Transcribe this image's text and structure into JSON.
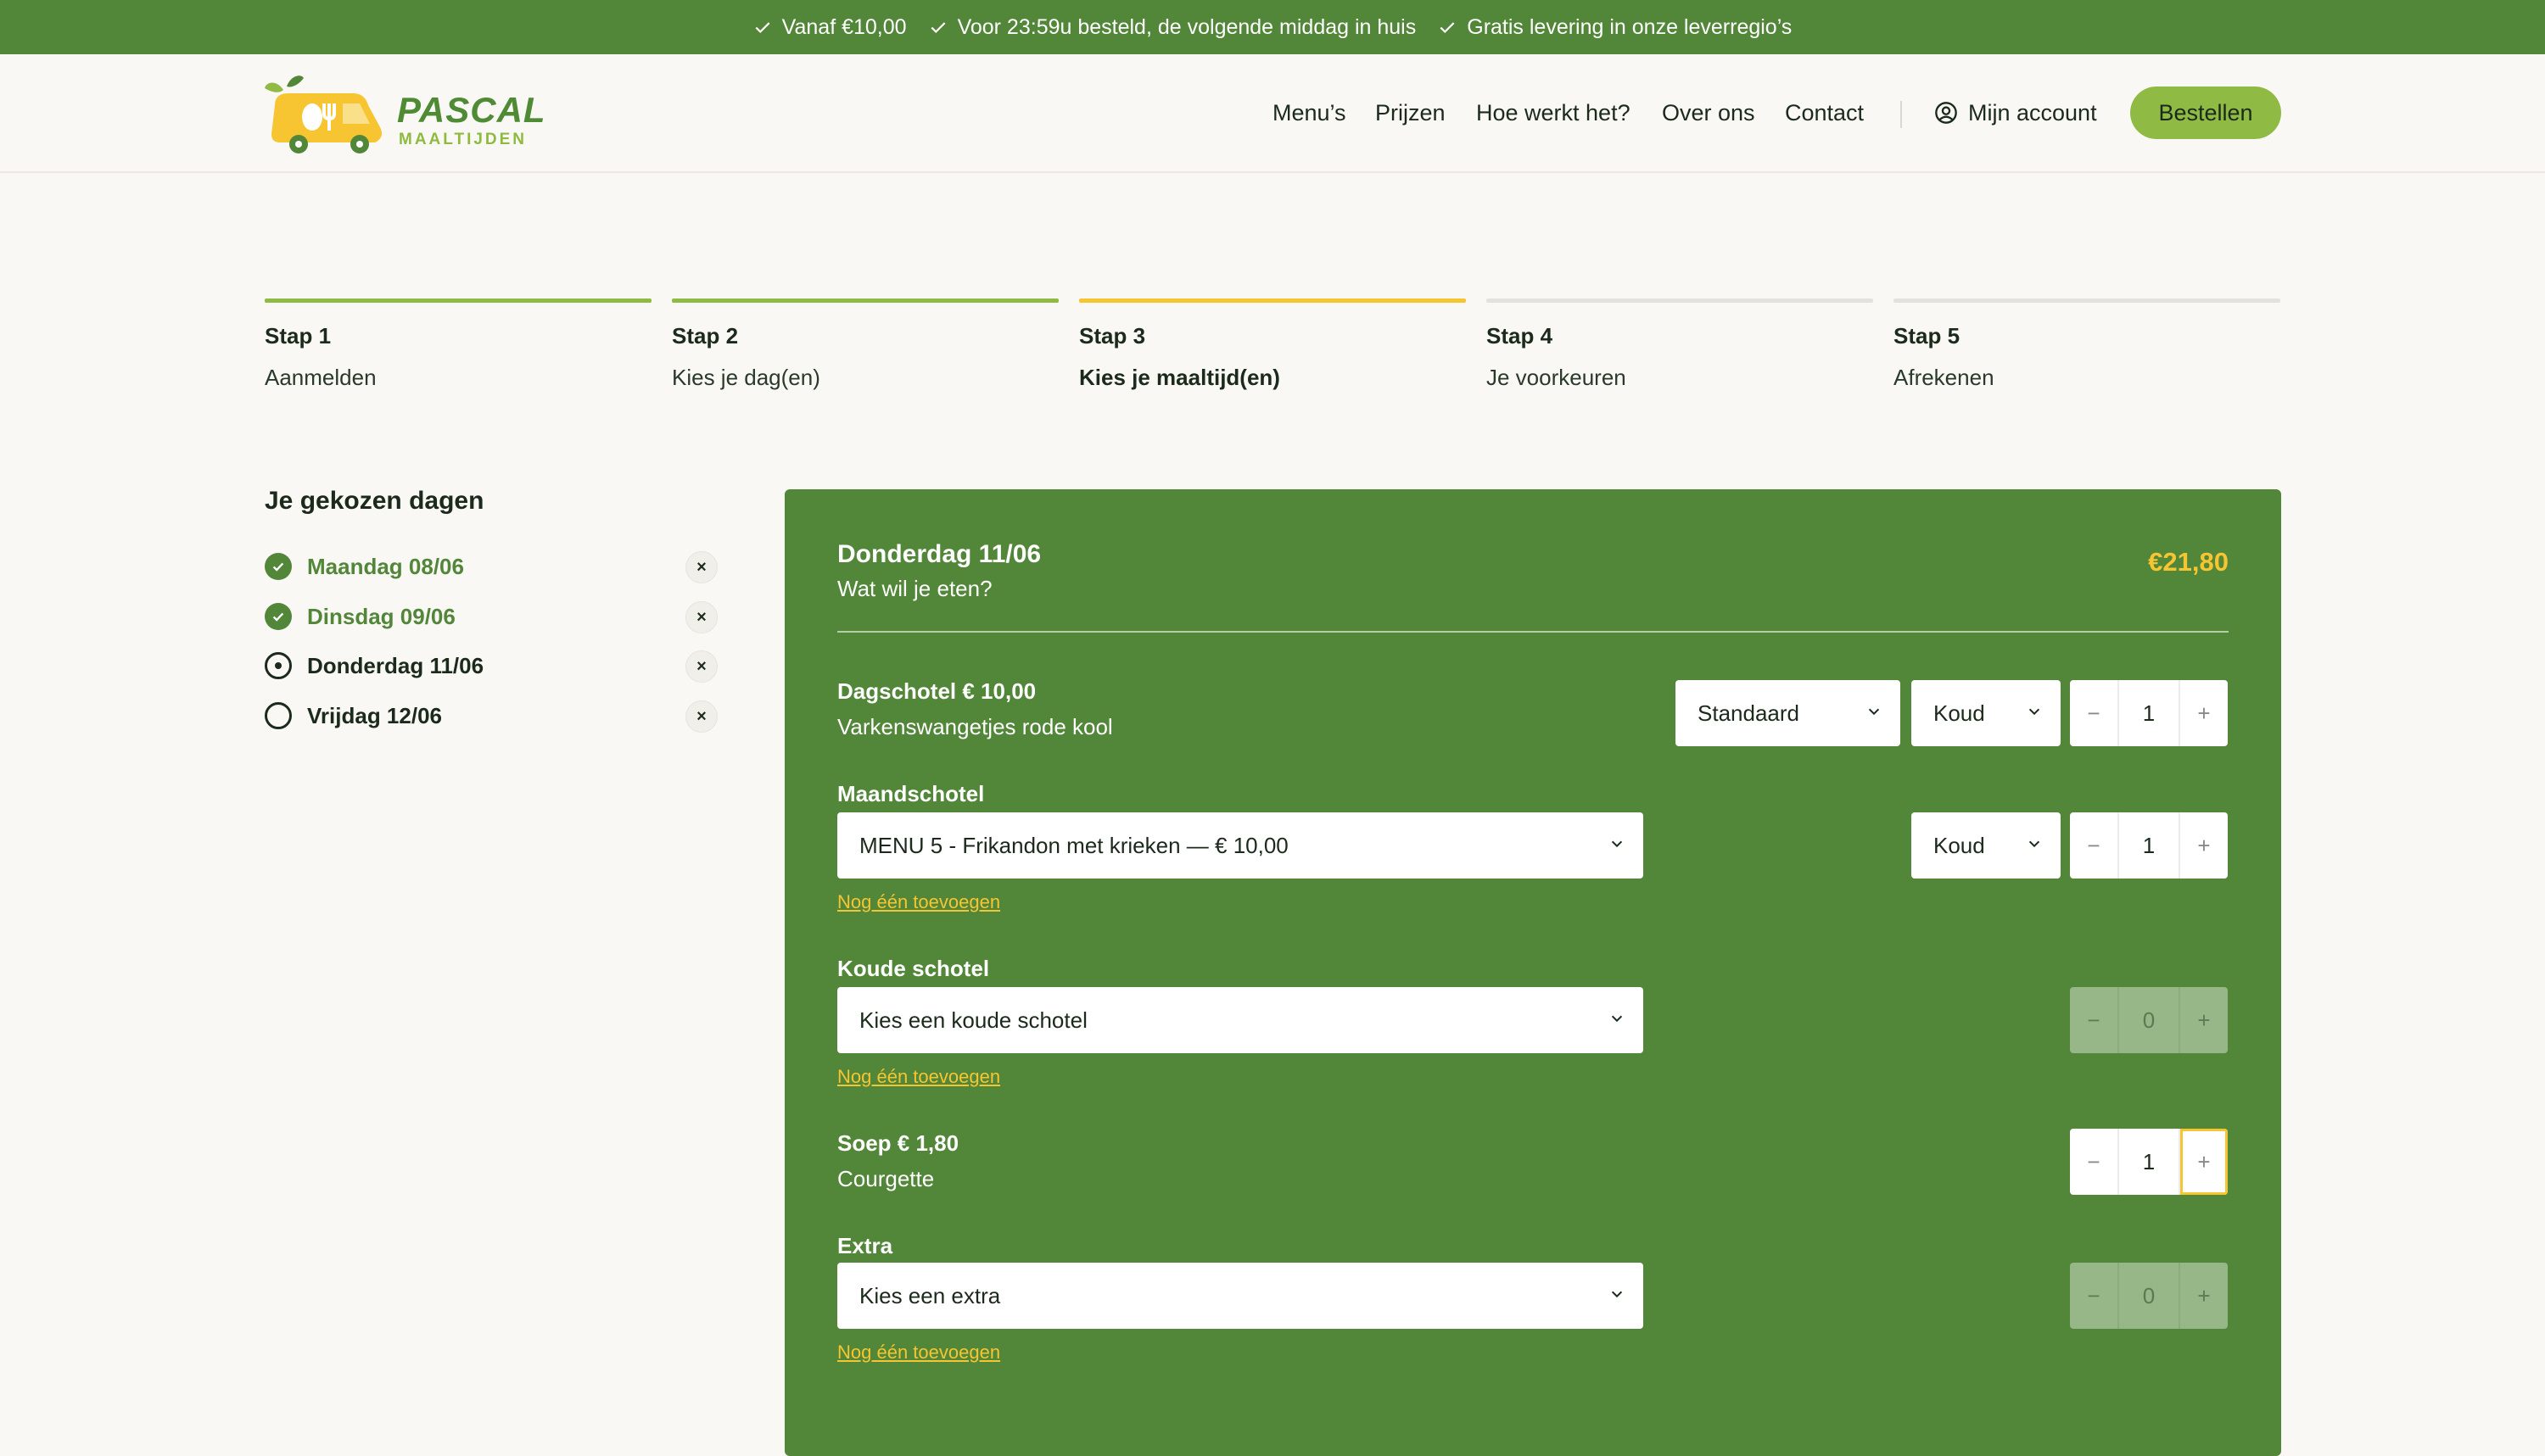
{
  "topbar": {
    "usps": [
      "Vanaf €10,00",
      "Voor 23:59u besteld, de volgende middag in huis",
      "Gratis levering in onze leverregio’s"
    ]
  },
  "header": {
    "logo_main": "PASCAL",
    "logo_sub": "MAALTIJDEN",
    "nav": [
      "Menu’s",
      "Prijzen",
      "Hoe werkt het?",
      "Over ons",
      "Contact"
    ],
    "account": "Mijn account",
    "order_button": "Bestellen"
  },
  "steps": [
    {
      "num": "Stap 1",
      "label": "Aanmelden",
      "state": "done",
      "color": "#8fbb44"
    },
    {
      "num": "Stap 2",
      "label": "Kies je dag(en)",
      "state": "done",
      "color": "#8fbb44"
    },
    {
      "num": "Stap 3",
      "label": "Kies je maaltijd(en)",
      "state": "active",
      "color": "#f7c531"
    },
    {
      "num": "Stap 4",
      "label": "Je voorkeuren",
      "state": "todo",
      "color": "#e4e2dc"
    },
    {
      "num": "Stap 5",
      "label": "Afrekenen",
      "state": "todo",
      "color": "#e4e2dc"
    }
  ],
  "sidebar": {
    "title": "Je gekozen dagen",
    "days": [
      {
        "label": "Maandag 08/06",
        "status": "done"
      },
      {
        "label": "Dinsdag 09/06",
        "status": "done"
      },
      {
        "label": "Donderdag 11/06",
        "status": "current"
      },
      {
        "label": "Vrijdag 12/06",
        "status": "todo"
      }
    ],
    "remove_glyph": "×"
  },
  "panel": {
    "day": "Donderdag 11/06",
    "subtitle": "Wat wil je eten?",
    "price": "€21,80",
    "add_link": "Nog één toevoegen",
    "minus": "−",
    "plus": "+",
    "dagschotel": {
      "title": "Dagschotel € 10,00",
      "desc": "Varkenswangetjes rode kool",
      "size_select": "Standaard",
      "temp_select": "Koud",
      "qty": "1"
    },
    "maandschotel": {
      "title": "Maandschotel",
      "select": "MENU 5 - Frikandon met krieken — € 10,00",
      "temp_select": "Koud",
      "qty": "1"
    },
    "koude_schotel": {
      "title": "Koude schotel",
      "select": "Kies een koude schotel",
      "qty": "0"
    },
    "soep": {
      "title": "Soep € 1,80",
      "desc": "Courgette",
      "qty": "1"
    },
    "extra": {
      "title": "Extra",
      "select": "Kies een extra",
      "qty": "0"
    }
  }
}
